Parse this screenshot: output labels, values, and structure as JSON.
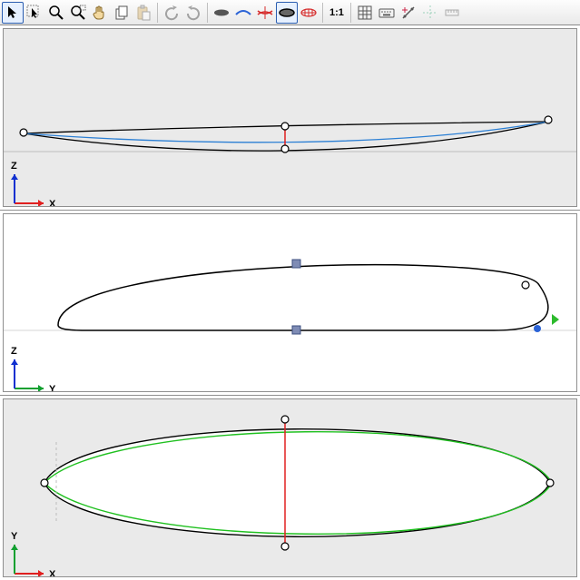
{
  "toolbar": {
    "ratio_label": "1:1",
    "buttons": [
      {
        "name": "pointer-tool",
        "icon": "pointer",
        "interactable": true,
        "selected": true
      },
      {
        "name": "edit-pointer-tool",
        "icon": "pointer-plus",
        "interactable": true
      },
      {
        "name": "zoom-tool",
        "icon": "magnifier",
        "interactable": true
      },
      {
        "name": "zoom-box-tool",
        "icon": "magnifier-plus",
        "interactable": true
      },
      {
        "name": "pan-tool",
        "icon": "hand",
        "interactable": true
      },
      {
        "name": "copy-tool",
        "icon": "copy",
        "interactable": true
      },
      {
        "name": "paste-tool",
        "icon": "paste",
        "interactable": true,
        "disabled": true
      },
      {
        "sep": true
      },
      {
        "name": "undo-tool",
        "icon": "undo",
        "interactable": true,
        "disabled": true
      },
      {
        "name": "redo-tool",
        "icon": "redo",
        "interactable": true,
        "disabled": true
      },
      {
        "sep": true
      },
      {
        "name": "solid-ellipse-tool",
        "icon": "ellipse-solid",
        "interactable": true
      },
      {
        "name": "curve-slice-tool",
        "icon": "curve-slice",
        "interactable": true
      },
      {
        "name": "mirror-curve-tool",
        "icon": "mirror-curve",
        "interactable": true
      },
      {
        "name": "outline-ellipse-tool",
        "icon": "ellipse-outline",
        "interactable": true,
        "selected": true
      },
      {
        "name": "wire-ellipse-tool",
        "icon": "ellipse-wire",
        "interactable": true
      },
      {
        "sep": true
      },
      {
        "name": "ratio-label",
        "text": "ratio_label",
        "interactable": false
      },
      {
        "sep": true
      },
      {
        "name": "grid-toggle",
        "icon": "grid",
        "interactable": true
      },
      {
        "name": "keyboard-toggle",
        "icon": "keyboard",
        "interactable": true
      },
      {
        "name": "snap-toggle",
        "icon": "snap",
        "interactable": true
      },
      {
        "name": "guides-toggle",
        "icon": "guides",
        "interactable": true,
        "disabled": true
      },
      {
        "name": "ruler-toggle",
        "icon": "ruler",
        "interactable": true,
        "disabled": true
      }
    ]
  },
  "views": [
    {
      "name": "side-profile-view",
      "shaded": true,
      "axes": {
        "h": "X",
        "h_color": "#e02020",
        "v": "Z",
        "v_color": "#1030d0"
      }
    },
    {
      "name": "slice-view",
      "shaded": false,
      "axes": {
        "h": "Y",
        "h_color": "#10a030",
        "v": "Z",
        "v_color": "#1030d0"
      }
    },
    {
      "name": "top-outline-view",
      "shaded": true,
      "axes": {
        "h": "X",
        "h_color": "#e02020",
        "v": "Y",
        "v_color": "#10a030"
      }
    }
  ]
}
